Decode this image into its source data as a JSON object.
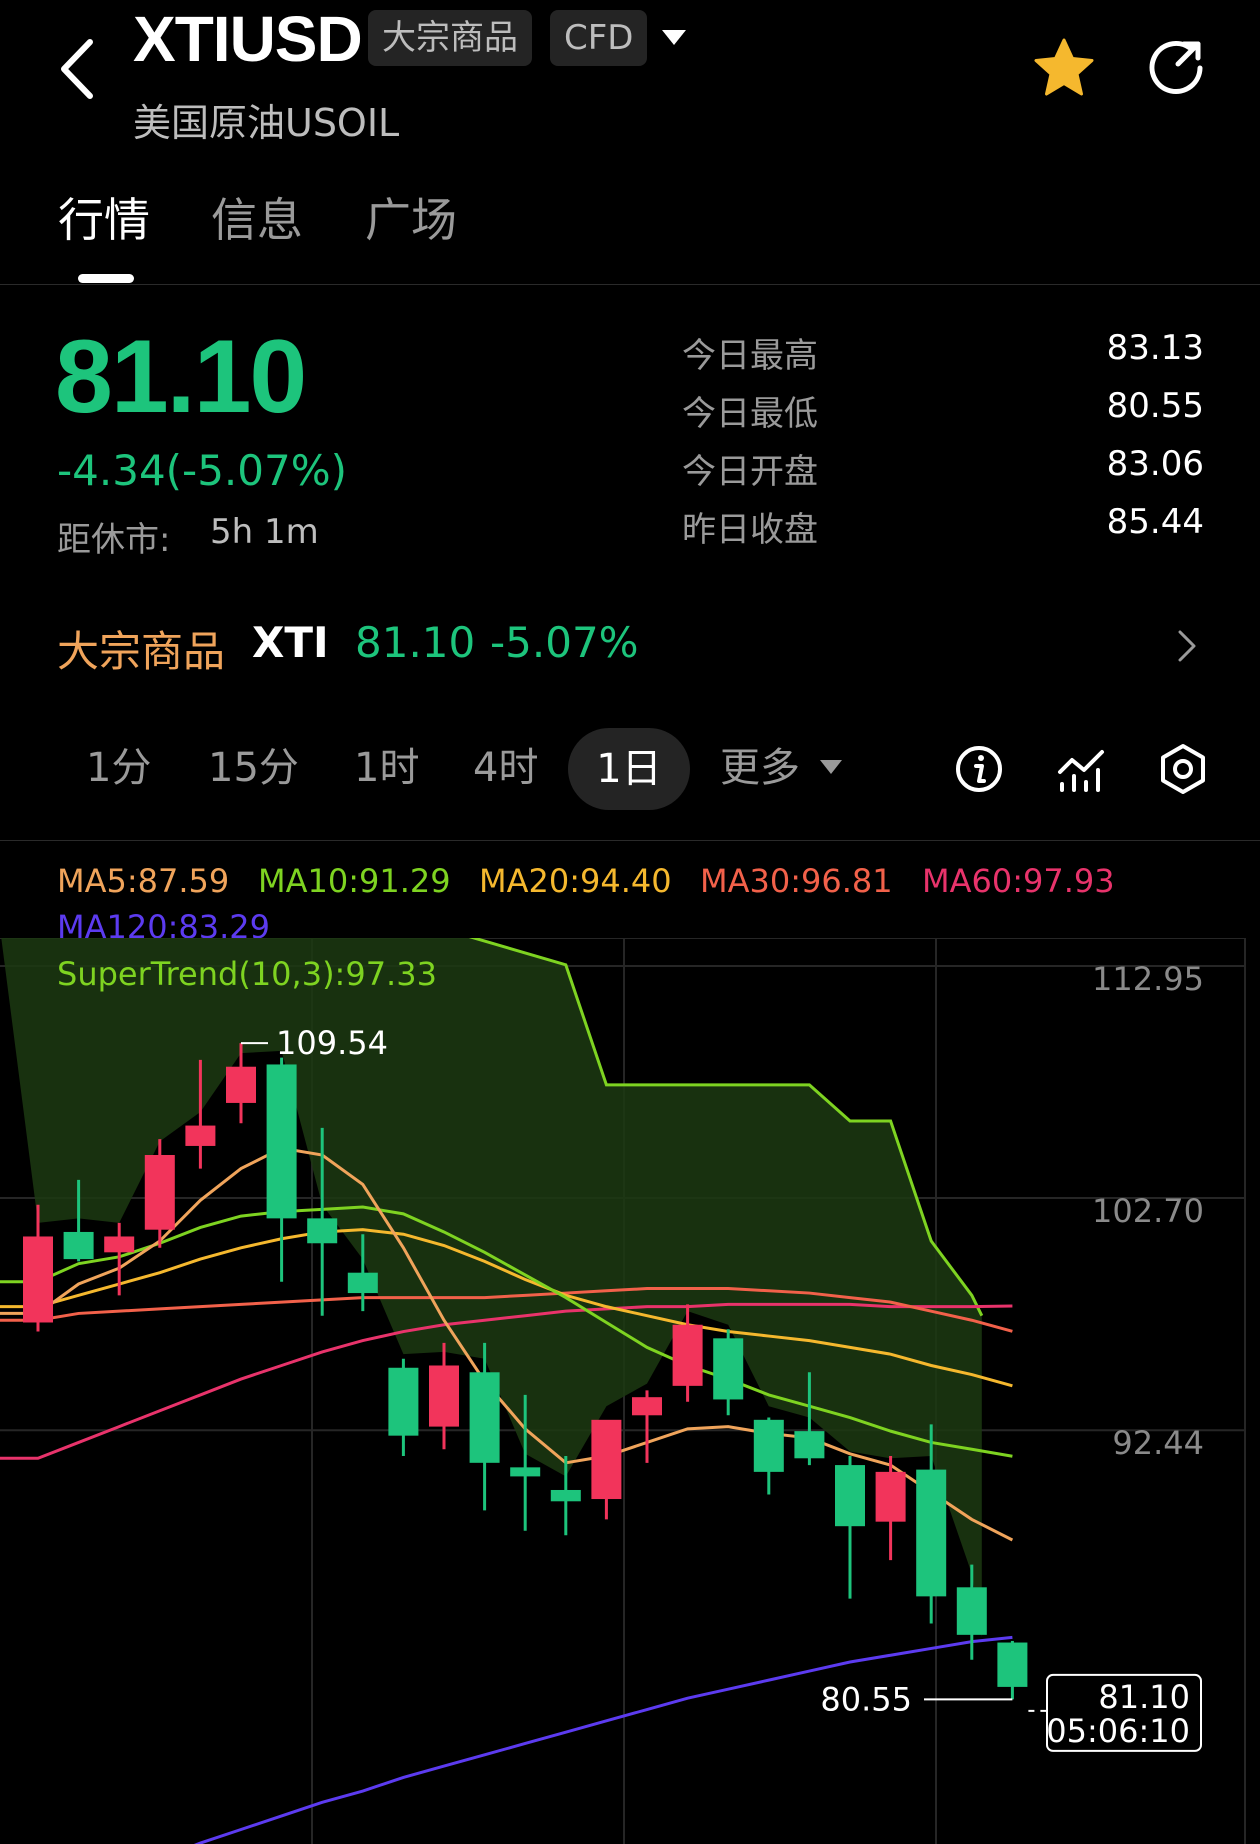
{
  "header": {
    "symbol": "XTIUSD",
    "tag_category": "大宗商品",
    "tag_type": "CFD",
    "subtitle": "美国原油USOIL"
  },
  "tabs": [
    {
      "label": "行情",
      "active": true
    },
    {
      "label": "信息",
      "active": false
    },
    {
      "label": "广场",
      "active": false
    }
  ],
  "quote": {
    "price": "81.10",
    "change": "-4.34(-5.07%)",
    "close_label": "距休市:",
    "close_value": "5h 1m",
    "stats": [
      {
        "label": "今日最高",
        "value": "83.13"
      },
      {
        "label": "今日最低",
        "value": "80.55"
      },
      {
        "label": "今日开盘",
        "value": "83.06"
      },
      {
        "label": "昨日收盘",
        "value": "85.44"
      }
    ]
  },
  "related": {
    "category": "大宗商品",
    "code": "XTI",
    "price": "81.10",
    "change": "-5.07%"
  },
  "periods": {
    "p1m": "1分",
    "p15m": "15分",
    "p1h": "1时",
    "p4h": "4时",
    "p1d": "1日",
    "more": "更多",
    "selected": "1日"
  },
  "indicators": {
    "ma5": "MA5:87.59",
    "ma10": "MA10:91.29",
    "ma20": "MA20:94.40",
    "ma30": "MA30:96.81",
    "ma60": "MA60:97.93",
    "ma120": "MA120:83.29",
    "supertrend": "SuperTrend(10,3):97.33"
  },
  "colors": {
    "up": "#f2345b",
    "down": "#1dc47c",
    "ma5": "#f0a45b",
    "ma10": "#7ed321",
    "ma20": "#f5b82e",
    "ma30": "#f2614a",
    "ma60": "#e8336b",
    "ma120": "#5c3bf0",
    "supertrend": "#7ed321",
    "supertrend_fill": "#1c3a12"
  },
  "chart_data": {
    "type": "candlestick",
    "y_ticks": [
      "112.95",
      "102.70",
      "92.44"
    ],
    "y_tick_values": [
      112.95,
      102.7,
      92.44
    ],
    "high_label": "109.54",
    "low_label": "80.55",
    "last_price_label": "81.10",
    "last_time_label": "05:06:10",
    "candles": [
      {
        "o": 97.2,
        "h": 102.4,
        "l": 96.8,
        "c": 101.0
      },
      {
        "o": 101.2,
        "h": 103.5,
        "l": 99.9,
        "c": 100.0
      },
      {
        "o": 100.3,
        "h": 101.6,
        "l": 98.4,
        "c": 101.0
      },
      {
        "o": 101.3,
        "h": 105.3,
        "l": 100.5,
        "c": 104.6
      },
      {
        "o": 105.0,
        "h": 108.8,
        "l": 104.0,
        "c": 105.9
      },
      {
        "o": 106.9,
        "h": 109.54,
        "l": 106.0,
        "c": 108.5
      },
      {
        "o": 108.6,
        "h": 108.9,
        "l": 99.0,
        "c": 101.8
      },
      {
        "o": 101.8,
        "h": 105.8,
        "l": 97.5,
        "c": 100.7
      },
      {
        "o": 99.4,
        "h": 101.1,
        "l": 97.7,
        "c": 98.5
      },
      {
        "o": 95.2,
        "h": 95.6,
        "l": 91.3,
        "c": 92.2
      },
      {
        "o": 92.6,
        "h": 96.3,
        "l": 91.6,
        "c": 95.3
      },
      {
        "o": 95.0,
        "h": 96.3,
        "l": 88.9,
        "c": 91.0
      },
      {
        "o": 90.8,
        "h": 94.0,
        "l": 88.0,
        "c": 90.4
      },
      {
        "o": 89.8,
        "h": 91.3,
        "l": 87.8,
        "c": 89.3
      },
      {
        "o": 89.4,
        "h": 92.5,
        "l": 88.5,
        "c": 92.9
      },
      {
        "o": 93.1,
        "h": 94.2,
        "l": 91.0,
        "c": 93.9
      },
      {
        "o": 94.4,
        "h": 98.0,
        "l": 93.7,
        "c": 97.1
      },
      {
        "o": 96.5,
        "h": 96.9,
        "l": 93.1,
        "c": 93.8
      },
      {
        "o": 92.9,
        "h": 93.0,
        "l": 89.6,
        "c": 90.6
      },
      {
        "o": 92.4,
        "h": 95.0,
        "l": 90.9,
        "c": 91.2
      },
      {
        "o": 90.9,
        "h": 91.3,
        "l": 85.0,
        "c": 88.2
      },
      {
        "o": 88.4,
        "h": 91.3,
        "l": 86.7,
        "c": 90.6
      },
      {
        "o": 90.7,
        "h": 92.7,
        "l": 83.9,
        "c": 85.1
      },
      {
        "o": 85.5,
        "h": 86.5,
        "l": 82.3,
        "c": 83.4
      },
      {
        "o": 83.06,
        "h": 83.13,
        "l": 80.55,
        "c": 81.1
      }
    ],
    "supertrend": [
      null,
      null,
      null,
      null,
      null,
      null,
      null,
      null,
      null,
      null,
      null,
      null,
      null,
      113.0,
      107.7,
      107.7,
      107.7,
      107.7,
      107.7,
      107.7,
      106.1,
      106.1,
      100.8,
      98.4,
      null
    ],
    "ma5": [
      97.6,
      98.9,
      99.6,
      100.8,
      102.6,
      104.0,
      104.9,
      104.6,
      103.3,
      100.5,
      97.3,
      94.6,
      92.5,
      91.0,
      91.3,
      91.9,
      92.5,
      92.6,
      92.3,
      92.1,
      91.4,
      90.9,
      89.7,
      88.5,
      87.59
    ],
    "ma10": [
      99.0,
      99.8,
      100.1,
      100.7,
      101.4,
      101.9,
      102.1,
      102.2,
      102.3,
      102.0,
      101.2,
      100.3,
      99.3,
      98.3,
      97.2,
      96.1,
      95.3,
      94.7,
      94.0,
      93.5,
      93.0,
      92.4,
      91.9,
      91.6,
      91.29
    ],
    "ma20": [
      97.9,
      98.4,
      98.9,
      99.4,
      100.0,
      100.5,
      100.9,
      101.2,
      101.3,
      101.1,
      100.6,
      99.9,
      99.1,
      98.4,
      97.9,
      97.5,
      97.1,
      96.8,
      96.6,
      96.4,
      96.1,
      95.8,
      95.3,
      94.9,
      94.4
    ],
    "ma30": [
      97.3,
      97.6,
      97.7,
      97.8,
      97.9,
      98.0,
      98.1,
      98.2,
      98.3,
      98.3,
      98.3,
      98.3,
      98.4,
      98.5,
      98.6,
      98.7,
      98.7,
      98.7,
      98.6,
      98.5,
      98.3,
      98.1,
      97.7,
      97.3,
      96.81
    ],
    "ma60": [
      91.2,
      91.9,
      92.6,
      93.3,
      94.0,
      94.7,
      95.3,
      95.9,
      96.4,
      96.8,
      97.1,
      97.3,
      97.5,
      97.7,
      97.8,
      97.9,
      97.9,
      98.0,
      98.0,
      98.0,
      98.0,
      97.9,
      97.9,
      97.9,
      97.93
    ],
    "ma120": [
      71.5,
      72.1,
      72.8,
      73.5,
      74.2,
      74.8,
      75.4,
      76.0,
      76.5,
      77.1,
      77.6,
      78.1,
      78.6,
      79.1,
      79.6,
      80.1,
      80.6,
      81.0,
      81.4,
      81.8,
      82.2,
      82.5,
      82.8,
      83.1,
      83.29
    ]
  }
}
